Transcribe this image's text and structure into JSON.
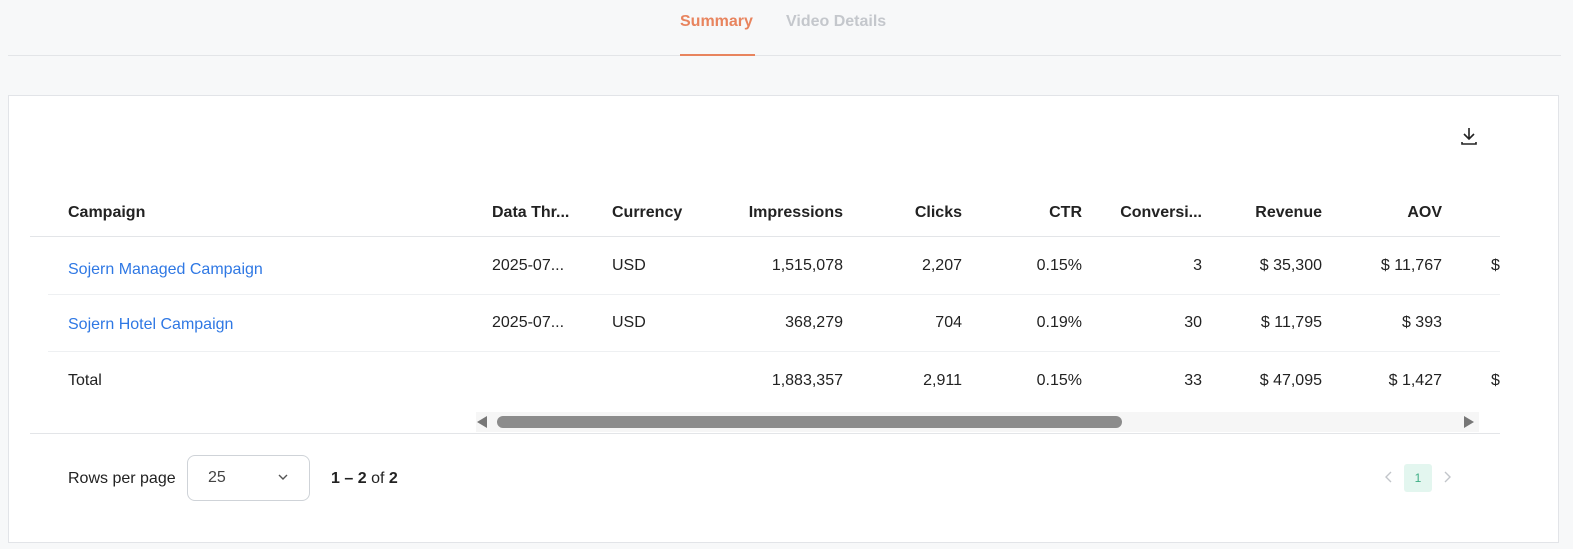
{
  "tabs": [
    {
      "label": "Summary",
      "active": true
    },
    {
      "label": "Video Details",
      "active": false
    }
  ],
  "table": {
    "columns": [
      "Campaign",
      "Data Thr...",
      "Currency",
      "Impressions",
      "Clicks",
      "CTR",
      "Conversi...",
      "Revenue",
      "AOV"
    ],
    "rows": [
      {
        "campaign": "Sojern Managed Campaign",
        "data_through": "2025-07...",
        "currency": "USD",
        "impressions": "1,515,078",
        "clicks": "2,207",
        "ctr": "0.15%",
        "conversions": "3",
        "revenue": "$ 35,300",
        "aov": "$ 11,767",
        "overflow": "$"
      },
      {
        "campaign": "Sojern Hotel Campaign",
        "data_through": "2025-07...",
        "currency": "USD",
        "impressions": "368,279",
        "clicks": "704",
        "ctr": "0.19%",
        "conversions": "30",
        "revenue": "$ 11,795",
        "aov": "$ 393",
        "overflow": ""
      }
    ],
    "total": {
      "label": "Total",
      "impressions": "1,883,357",
      "clicks": "2,911",
      "ctr": "0.15%",
      "conversions": "33",
      "revenue": "$ 47,095",
      "aov": "$ 1,427",
      "overflow": "$"
    }
  },
  "pagination": {
    "rows_per_page_label": "Rows per page",
    "rows_per_page": "25",
    "range_start": "1",
    "range_end": "2",
    "range_of": "of",
    "total": "2",
    "current_page": "1"
  },
  "icons": {
    "download": "download-icon",
    "chevron": "chevron-down-icon"
  },
  "colors": {
    "accent": "#e8845e",
    "link": "#2f78e4",
    "page_active_bg": "#e3f6ef",
    "page_active_fg": "#3fae85"
  }
}
